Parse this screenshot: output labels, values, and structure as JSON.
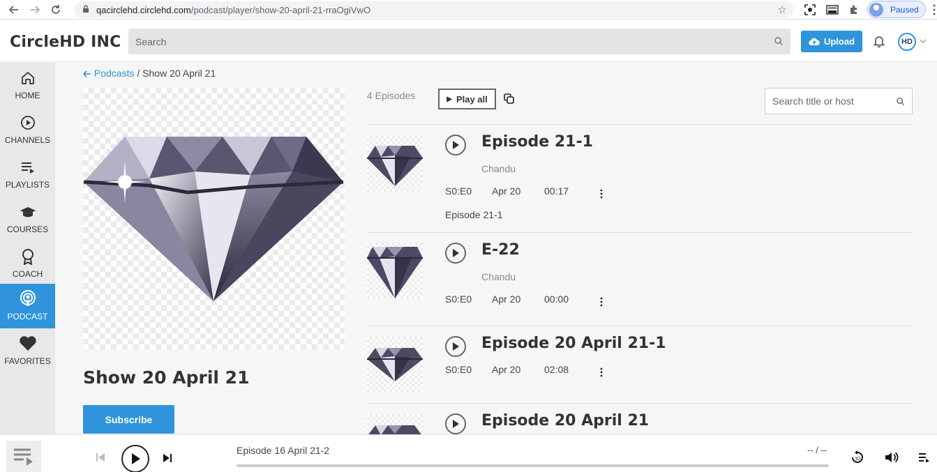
{
  "browser": {
    "url_host": "qacirclehd.circlehd.com",
    "url_path": "/podcast/player/show-20-april-21-rraOgiVwO",
    "profile_status": "Paused"
  },
  "header": {
    "brand": "CircleHD INC",
    "search_placeholder": "Search",
    "upload_label": "Upload",
    "logo_text": "HD"
  },
  "sidebar": {
    "items": [
      {
        "label": "HOME",
        "icon": "home-icon"
      },
      {
        "label": "CHANNELS",
        "icon": "play-circle-icon"
      },
      {
        "label": "PLAYLISTS",
        "icon": "playlist-icon"
      },
      {
        "label": "COURSES",
        "icon": "graduation-cap-icon"
      },
      {
        "label": "COACH",
        "icon": "award-icon"
      },
      {
        "label": "PODCAST",
        "icon": "podcast-icon",
        "active": true
      },
      {
        "label": "FAVORITES",
        "icon": "heart-icon"
      }
    ]
  },
  "breadcrumb": {
    "back_label": "Podcasts",
    "separator": "/",
    "current": "Show 20 April 21"
  },
  "show": {
    "title": "Show 20 April 21",
    "subscribe_label": "Subscribe"
  },
  "episodes_header": {
    "count_label": "4 Episodes",
    "play_all_label": "Play all",
    "search_placeholder": "Search title or host"
  },
  "episodes": [
    {
      "title": "Episode 21-1",
      "host": "Chandu",
      "season_episode": "S0:E0",
      "date": "Apr 20",
      "duration": "00:17",
      "description": "Episode 21-1"
    },
    {
      "title": "E-22",
      "host": "Chandu",
      "season_episode": "S0:E0",
      "date": "Apr 20",
      "duration": "00:00",
      "description": ""
    },
    {
      "title": "Episode 20 April 21-1",
      "host": "",
      "season_episode": "S0:E0",
      "date": "Apr 20",
      "duration": "02:08",
      "description": ""
    },
    {
      "title": "Episode 20 April 21",
      "host": "",
      "season_episode": "",
      "date": "",
      "duration": "",
      "description": ""
    }
  ],
  "player": {
    "now_playing": "Episode 16 April 21-2",
    "time": "-- / --",
    "progress": 0
  },
  "colors": {
    "accent": "#2f94db",
    "sidebar_bg": "#e8e8e8",
    "page_bg": "#f6f6f6"
  }
}
